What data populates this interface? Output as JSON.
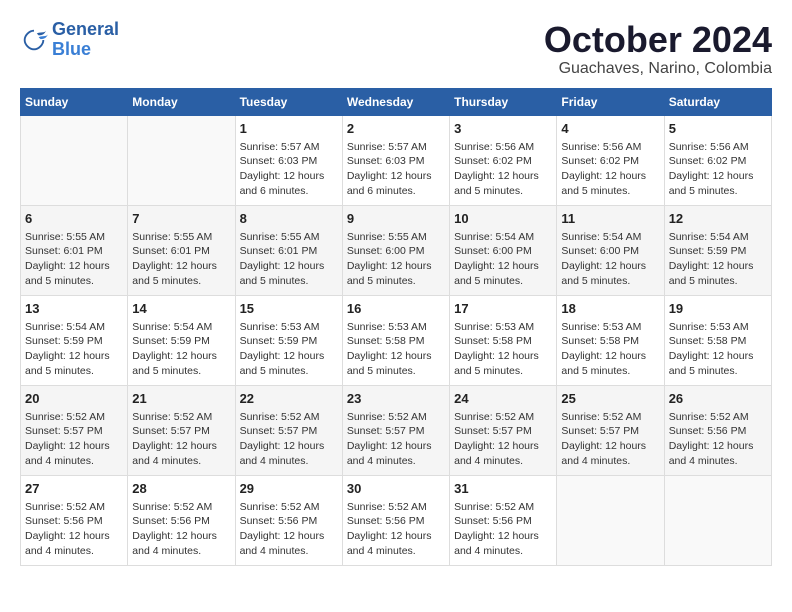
{
  "logo": {
    "line1": "General",
    "line2": "Blue"
  },
  "title": "October 2024",
  "location": "Guachaves, Narino, Colombia",
  "days_of_week": [
    "Sunday",
    "Monday",
    "Tuesday",
    "Wednesday",
    "Thursday",
    "Friday",
    "Saturday"
  ],
  "weeks": [
    [
      {
        "day": "",
        "info": ""
      },
      {
        "day": "",
        "info": ""
      },
      {
        "day": "1",
        "info": "Sunrise: 5:57 AM\nSunset: 6:03 PM\nDaylight: 12 hours\nand 6 minutes."
      },
      {
        "day": "2",
        "info": "Sunrise: 5:57 AM\nSunset: 6:03 PM\nDaylight: 12 hours\nand 6 minutes."
      },
      {
        "day": "3",
        "info": "Sunrise: 5:56 AM\nSunset: 6:02 PM\nDaylight: 12 hours\nand 5 minutes."
      },
      {
        "day": "4",
        "info": "Sunrise: 5:56 AM\nSunset: 6:02 PM\nDaylight: 12 hours\nand 5 minutes."
      },
      {
        "day": "5",
        "info": "Sunrise: 5:56 AM\nSunset: 6:02 PM\nDaylight: 12 hours\nand 5 minutes."
      }
    ],
    [
      {
        "day": "6",
        "info": "Sunrise: 5:55 AM\nSunset: 6:01 PM\nDaylight: 12 hours\nand 5 minutes."
      },
      {
        "day": "7",
        "info": "Sunrise: 5:55 AM\nSunset: 6:01 PM\nDaylight: 12 hours\nand 5 minutes."
      },
      {
        "day": "8",
        "info": "Sunrise: 5:55 AM\nSunset: 6:01 PM\nDaylight: 12 hours\nand 5 minutes."
      },
      {
        "day": "9",
        "info": "Sunrise: 5:55 AM\nSunset: 6:00 PM\nDaylight: 12 hours\nand 5 minutes."
      },
      {
        "day": "10",
        "info": "Sunrise: 5:54 AM\nSunset: 6:00 PM\nDaylight: 12 hours\nand 5 minutes."
      },
      {
        "day": "11",
        "info": "Sunrise: 5:54 AM\nSunset: 6:00 PM\nDaylight: 12 hours\nand 5 minutes."
      },
      {
        "day": "12",
        "info": "Sunrise: 5:54 AM\nSunset: 5:59 PM\nDaylight: 12 hours\nand 5 minutes."
      }
    ],
    [
      {
        "day": "13",
        "info": "Sunrise: 5:54 AM\nSunset: 5:59 PM\nDaylight: 12 hours\nand 5 minutes."
      },
      {
        "day": "14",
        "info": "Sunrise: 5:54 AM\nSunset: 5:59 PM\nDaylight: 12 hours\nand 5 minutes."
      },
      {
        "day": "15",
        "info": "Sunrise: 5:53 AM\nSunset: 5:59 PM\nDaylight: 12 hours\nand 5 minutes."
      },
      {
        "day": "16",
        "info": "Sunrise: 5:53 AM\nSunset: 5:58 PM\nDaylight: 12 hours\nand 5 minutes."
      },
      {
        "day": "17",
        "info": "Sunrise: 5:53 AM\nSunset: 5:58 PM\nDaylight: 12 hours\nand 5 minutes."
      },
      {
        "day": "18",
        "info": "Sunrise: 5:53 AM\nSunset: 5:58 PM\nDaylight: 12 hours\nand 5 minutes."
      },
      {
        "day": "19",
        "info": "Sunrise: 5:53 AM\nSunset: 5:58 PM\nDaylight: 12 hours\nand 5 minutes."
      }
    ],
    [
      {
        "day": "20",
        "info": "Sunrise: 5:52 AM\nSunset: 5:57 PM\nDaylight: 12 hours\nand 4 minutes."
      },
      {
        "day": "21",
        "info": "Sunrise: 5:52 AM\nSunset: 5:57 PM\nDaylight: 12 hours\nand 4 minutes."
      },
      {
        "day": "22",
        "info": "Sunrise: 5:52 AM\nSunset: 5:57 PM\nDaylight: 12 hours\nand 4 minutes."
      },
      {
        "day": "23",
        "info": "Sunrise: 5:52 AM\nSunset: 5:57 PM\nDaylight: 12 hours\nand 4 minutes."
      },
      {
        "day": "24",
        "info": "Sunrise: 5:52 AM\nSunset: 5:57 PM\nDaylight: 12 hours\nand 4 minutes."
      },
      {
        "day": "25",
        "info": "Sunrise: 5:52 AM\nSunset: 5:57 PM\nDaylight: 12 hours\nand 4 minutes."
      },
      {
        "day": "26",
        "info": "Sunrise: 5:52 AM\nSunset: 5:56 PM\nDaylight: 12 hours\nand 4 minutes."
      }
    ],
    [
      {
        "day": "27",
        "info": "Sunrise: 5:52 AM\nSunset: 5:56 PM\nDaylight: 12 hours\nand 4 minutes."
      },
      {
        "day": "28",
        "info": "Sunrise: 5:52 AM\nSunset: 5:56 PM\nDaylight: 12 hours\nand 4 minutes."
      },
      {
        "day": "29",
        "info": "Sunrise: 5:52 AM\nSunset: 5:56 PM\nDaylight: 12 hours\nand 4 minutes."
      },
      {
        "day": "30",
        "info": "Sunrise: 5:52 AM\nSunset: 5:56 PM\nDaylight: 12 hours\nand 4 minutes."
      },
      {
        "day": "31",
        "info": "Sunrise: 5:52 AM\nSunset: 5:56 PM\nDaylight: 12 hours\nand 4 minutes."
      },
      {
        "day": "",
        "info": ""
      },
      {
        "day": "",
        "info": ""
      }
    ]
  ]
}
